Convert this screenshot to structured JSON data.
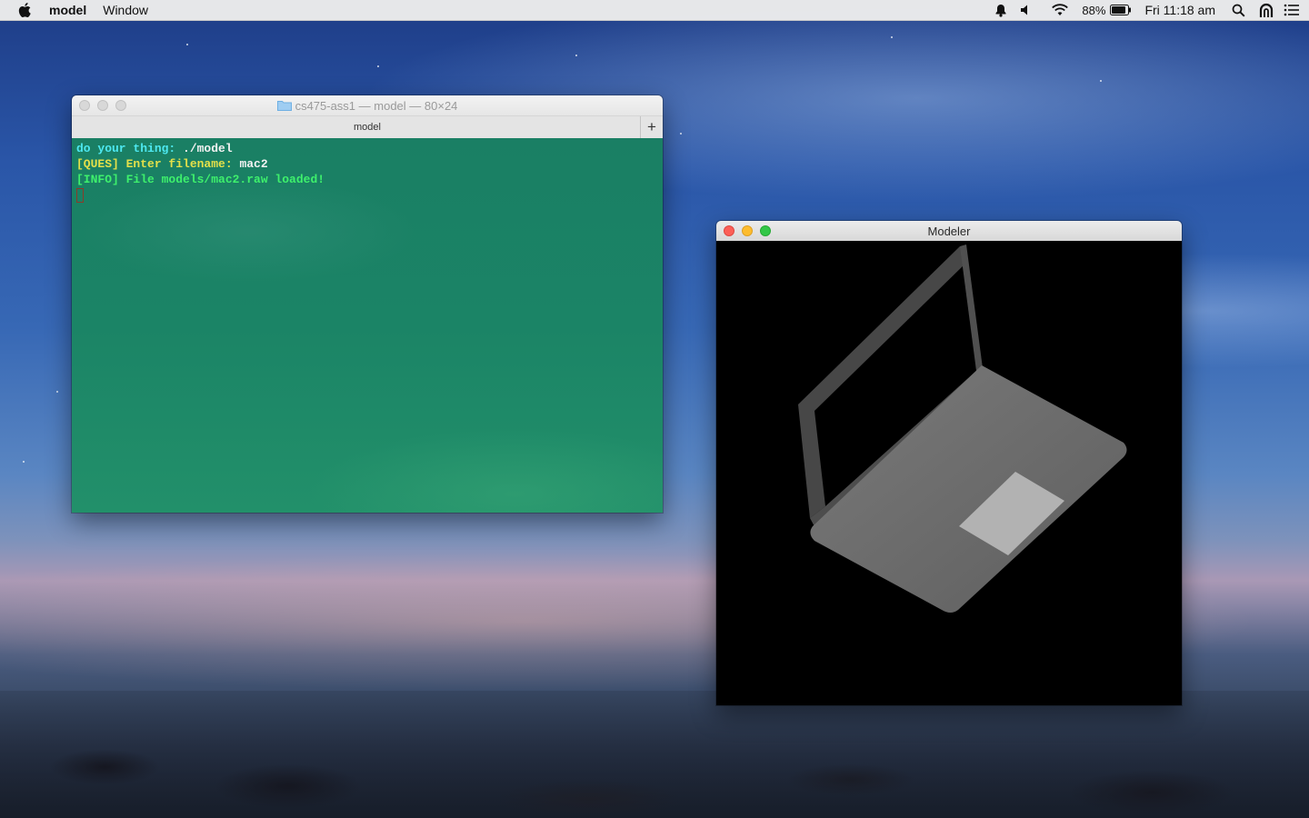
{
  "menubar": {
    "apple_icon": "apple-logo",
    "app_name": "model",
    "items": [
      "Window"
    ],
    "status": {
      "notification_icon": "bell-icon",
      "volume_icon": "speaker-icon",
      "wifi_icon": "wifi-icon",
      "battery_percent": "88%",
      "battery_level": 0.88,
      "clock": "Fri 11:18 am",
      "spotlight_icon": "search-icon",
      "user_icon": "user-icon",
      "notification_center_icon": "list-icon"
    }
  },
  "terminal": {
    "window_title": "cs475-ass1 — model — 80×24",
    "tab_title": "model",
    "new_tab_label": "+",
    "background_color": "#1b8466",
    "lines": [
      {
        "prompt": "do your thing:",
        "command": " ./model"
      },
      {
        "prefix": "[QUES] Enter filename:",
        "value": " mac2"
      },
      {
        "text": "[INFO] File models/mac2.raw loaded!"
      }
    ]
  },
  "modeler": {
    "window_title": "Modeler",
    "viewport_background": "#000000",
    "model_colors": {
      "screen_frame": "#474747",
      "base": "#6e6e6e",
      "trackpad": "#b2b2b2"
    }
  }
}
